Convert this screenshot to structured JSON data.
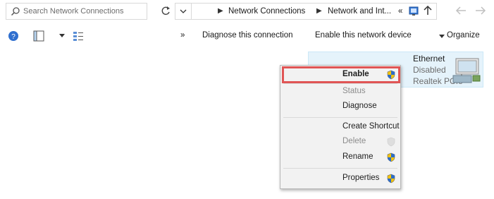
{
  "window": {
    "search_placeholder": "Search Network Connections",
    "breadcrumb": [
      "Network and Int...",
      "Network Connections"
    ],
    "breadcrumb_prefix": "«"
  },
  "toolbar": {
    "organize": "Organize",
    "enable": "Enable this network device",
    "diagnose": "Diagnose this connection",
    "more": "»"
  },
  "adapter": {
    "name": "Ethernet",
    "status": "Disabled",
    "device": "Realtek PCIe"
  },
  "context_menu": {
    "items": [
      {
        "label": "Enable",
        "shield": true,
        "disabled": false,
        "bold": true
      },
      {
        "label": "Status",
        "shield": false,
        "disabled": true,
        "bold": false
      },
      {
        "label": "Diagnose",
        "shield": false,
        "disabled": false,
        "bold": false
      },
      {
        "label": "Create Shortcut",
        "shield": false,
        "disabled": false,
        "bold": false
      },
      {
        "label": "Delete",
        "shield": true,
        "disabled": true,
        "bold": false
      },
      {
        "label": "Rename",
        "shield": true,
        "disabled": false,
        "bold": false
      },
      {
        "label": "Properties",
        "shield": true,
        "disabled": false,
        "bold": false
      }
    ]
  },
  "colors": {
    "highlight_border": "#e05555",
    "selection_bg": "#e5f3fb"
  }
}
